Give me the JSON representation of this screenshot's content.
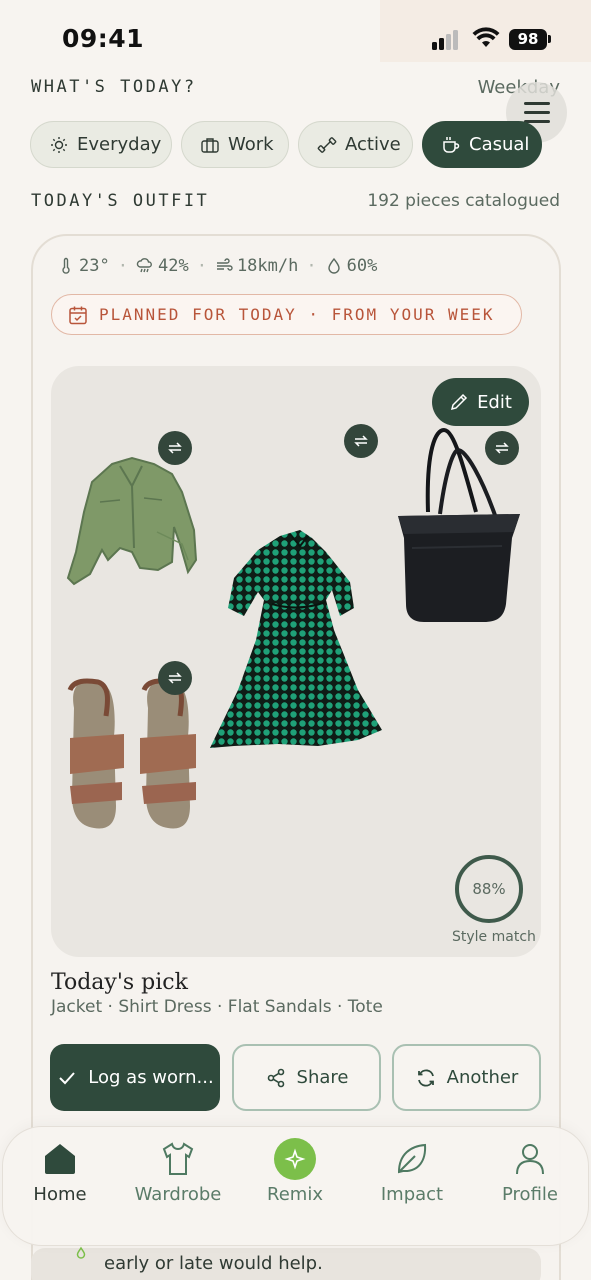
{
  "status_bar": {
    "time": "09:41",
    "battery": "98"
  },
  "header": {
    "title": "WHAT'S TODAY?",
    "day_type": "Weekday"
  },
  "chips": [
    {
      "label": "Everyday",
      "icon": "sun-icon",
      "selected": false
    },
    {
      "label": "Work",
      "icon": "briefcase-icon",
      "selected": false
    },
    {
      "label": "Active",
      "icon": "dumbbell-icon",
      "selected": false
    },
    {
      "label": "Casual",
      "icon": "coffee-cup-icon",
      "selected": true
    }
  ],
  "outfit_section": {
    "title": "TODAY'S OUTFIT",
    "pieces_count": "192 pieces catalogued"
  },
  "weather": {
    "temperature": "23°",
    "precipitation": "42%",
    "wind": "18km/h",
    "humidity": "60%"
  },
  "planned_badge": "PLANNED FOR TODAY · FROM YOUR WEEK",
  "edit_label": "Edit",
  "garments": [
    "jacket",
    "shirt-dress",
    "tote-bag",
    "flat-sandals"
  ],
  "style_match": {
    "value": "88%",
    "label": "Style match",
    "fraction": 0.88
  },
  "pick": {
    "title": "Today's pick",
    "items": "Jacket · Shirt Dress · Flat Sandals · Tote"
  },
  "actions": {
    "log": "Log as worn...",
    "share": "Share",
    "another": "Another"
  },
  "bottom_note": "early or late would help.",
  "tabs": [
    {
      "label": "Home",
      "icon": "home-icon",
      "active": true
    },
    {
      "label": "Wardrobe",
      "icon": "tshirt-icon",
      "active": false
    },
    {
      "label": "Remix",
      "icon": "sparkle-icon",
      "active": false
    },
    {
      "label": "Impact",
      "icon": "leaf-icon",
      "active": false
    },
    {
      "label": "Profile",
      "icon": "user-icon",
      "active": false
    }
  ],
  "colors": {
    "accent_dark_green": "#2f4a3c",
    "planned_orange": "#b8553a",
    "remix_green": "#7cbf4a",
    "background": "#f7f4f0"
  }
}
